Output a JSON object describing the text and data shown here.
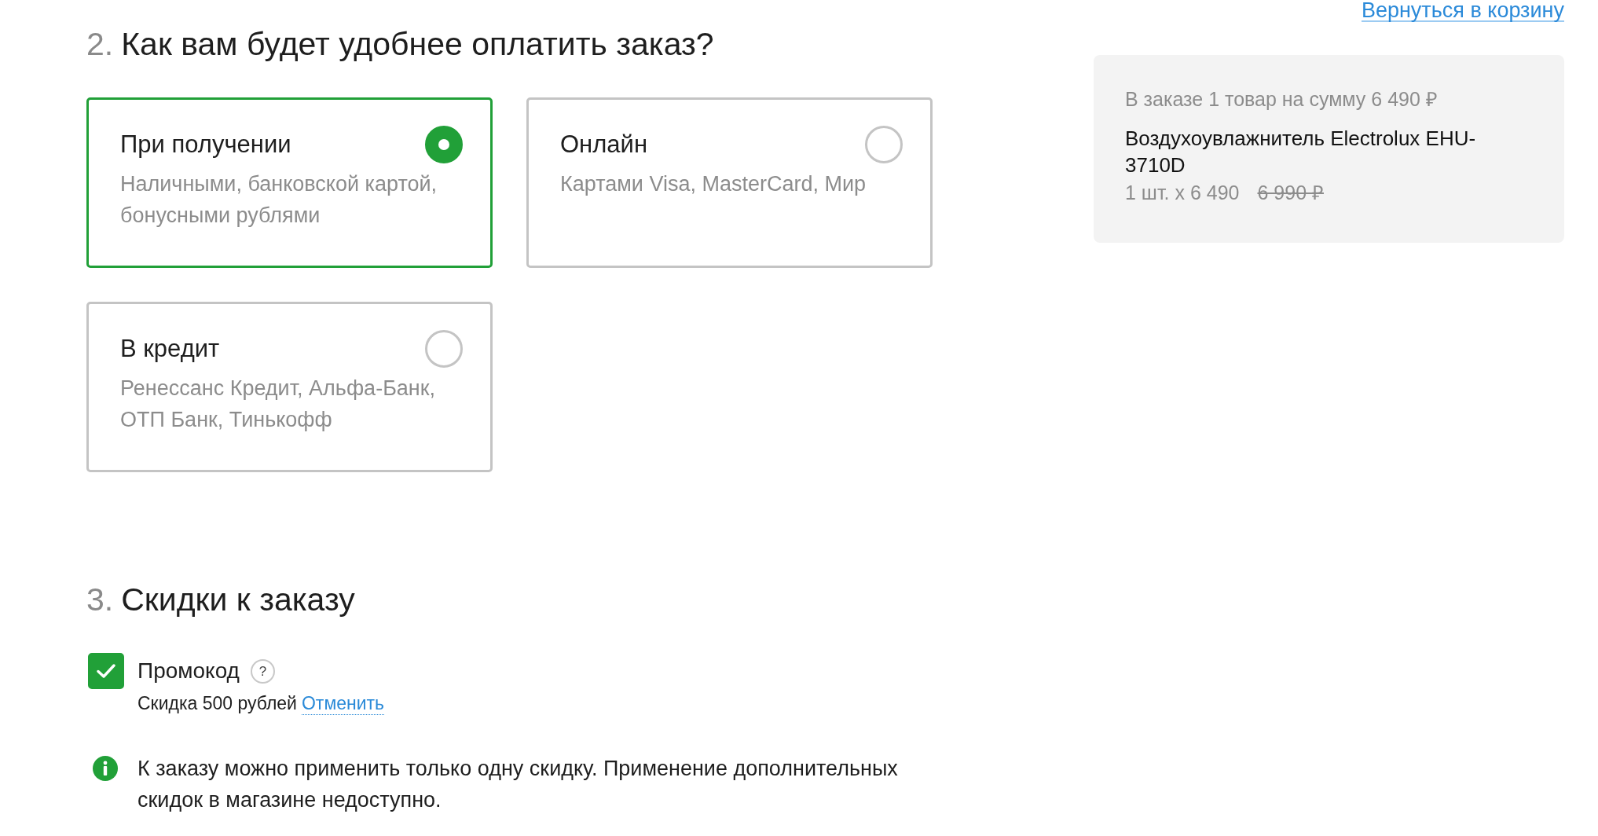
{
  "back_link": "Вернуться в корзину",
  "payment_section": {
    "number": "2.",
    "title": "Как вам будет удобнее оплатить заказ?",
    "options": [
      {
        "title": "При получении",
        "description": "Наличными, банковской картой, бонусными рублями",
        "selected": true
      },
      {
        "title": "Онлайн",
        "description": "Картами Visa, MasterCard, Мир",
        "selected": false
      },
      {
        "title": "В кредит",
        "description": "Ренессанс Кредит, Альфа-Банк, ОТП Банк, Тинькофф",
        "selected": false
      }
    ]
  },
  "order_summary": {
    "count_line": "В заказе 1 товар на сумму 6 490 ₽",
    "product_name": "Воздухоувлажнитель Electrolux EHU-3710D",
    "quantity_price": "1 шт. x 6 490",
    "old_price": "6 990 ₽"
  },
  "discount_section": {
    "number": "3.",
    "title": "Скидки к заказу",
    "promo": {
      "label": "Промокод",
      "checked": true,
      "help": "?",
      "discount_text": "Скидка 500 рублей",
      "cancel_link": "Отменить"
    },
    "info": "К заказу можно применить только одну скидку. Применение дополнительных скидок в магазине недоступно."
  }
}
